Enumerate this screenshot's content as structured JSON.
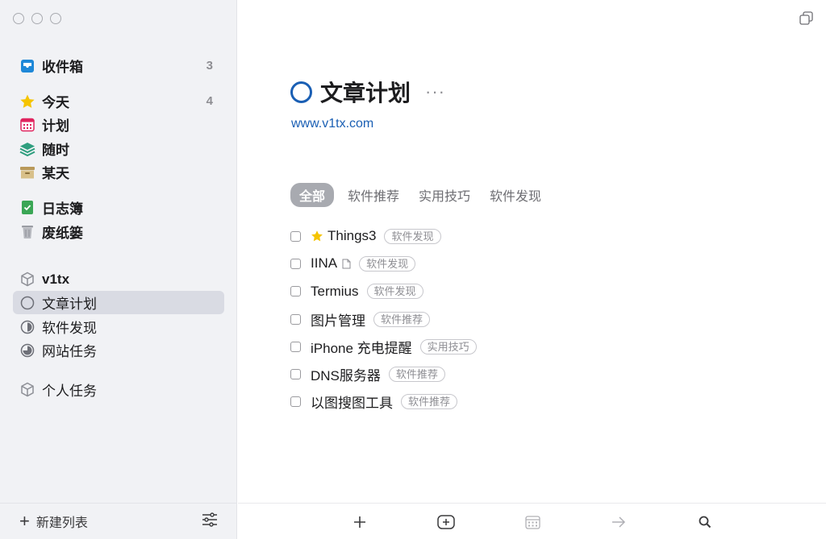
{
  "sidebar": {
    "inbox": {
      "label": "收件箱",
      "count": "3",
      "icon": "inbox-icon"
    },
    "today": {
      "label": "今天",
      "count": "4",
      "icon": "star-icon"
    },
    "upcoming": {
      "label": "计划",
      "icon": "calendar-icon"
    },
    "anytime": {
      "label": "随时",
      "icon": "layers-icon"
    },
    "someday": {
      "label": "某天",
      "icon": "archive-box-icon"
    },
    "logbook": {
      "label": "日志簿",
      "icon": "logbook-icon"
    },
    "trash": {
      "label": "废纸篓",
      "icon": "trash-icon"
    },
    "area1": {
      "label": "v1tx",
      "icon": "cube-icon"
    },
    "projects": [
      {
        "label": "文章计划",
        "icon": "circle-icon",
        "selected": true
      },
      {
        "label": "软件发现",
        "icon": "half-circle-icon"
      },
      {
        "label": "网站任务",
        "icon": "three-quarter-circle-icon"
      }
    ],
    "area2": {
      "label": "个人任务",
      "icon": "cube-icon"
    },
    "footer": {
      "new_list": "新建列表"
    }
  },
  "main": {
    "title": "文章计划",
    "more": "···",
    "notes_link": "www.v1tx.com",
    "tag_filters": [
      "全部",
      "软件推荐",
      "实用技巧",
      "软件发现"
    ],
    "todos": [
      {
        "title": "Things3",
        "tag": "软件发现",
        "starred": true,
        "has_note": false
      },
      {
        "title": "IINA",
        "tag": "软件发现",
        "starred": false,
        "has_note": true
      },
      {
        "title": "Termius",
        "tag": "软件发现",
        "starred": false,
        "has_note": false
      },
      {
        "title": "图片管理",
        "tag": "软件推荐",
        "starred": false,
        "has_note": false
      },
      {
        "title": "iPhone 充电提醒",
        "tag": "实用技巧",
        "starred": false,
        "has_note": false
      },
      {
        "title": "DNS服务器",
        "tag": "软件推荐",
        "starred": false,
        "has_note": false
      },
      {
        "title": "以图搜图工具",
        "tag": "软件推荐",
        "starred": false,
        "has_note": false
      }
    ]
  },
  "colors": {
    "accent": "#1a5fb4",
    "sidebar_bg": "#f1f2f5",
    "selected_bg": "#d9dbe3",
    "star": "#f5c400",
    "calendar": "#e0245e",
    "layers": "#2e9e7e",
    "someday": "#c9ad6a",
    "logbook": "#3aa655"
  }
}
